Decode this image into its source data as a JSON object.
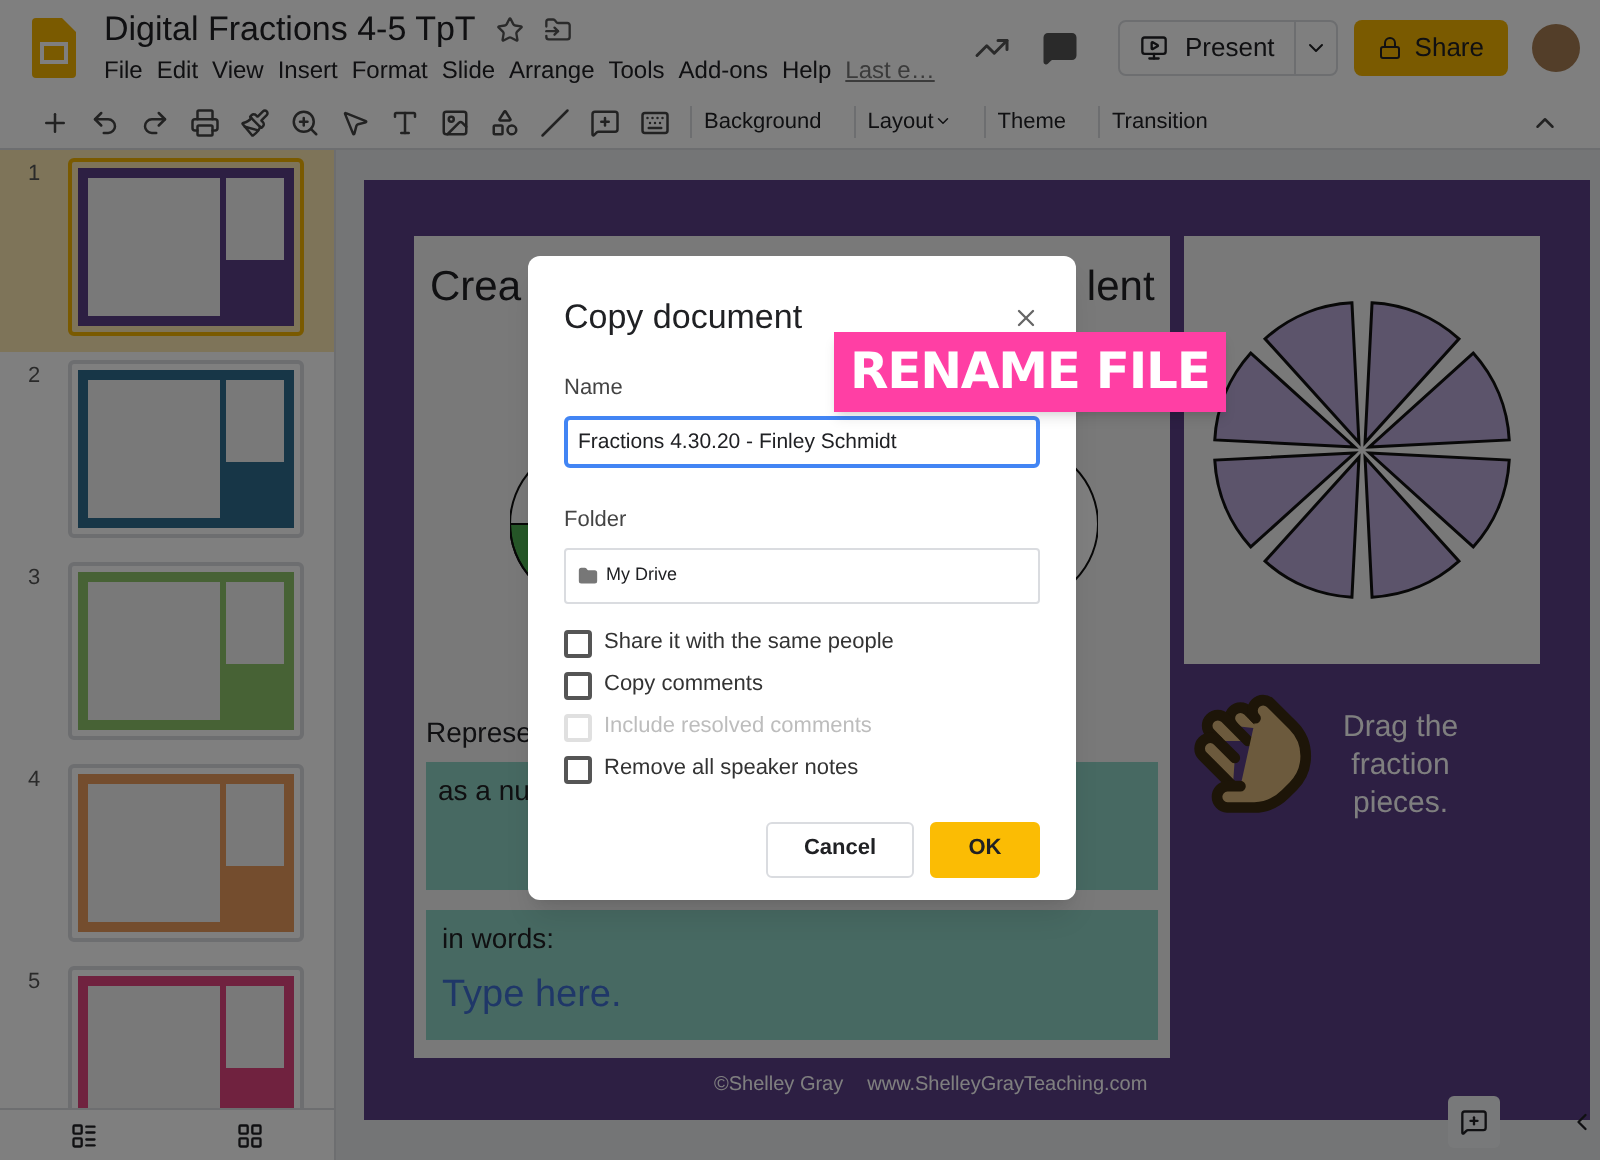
{
  "app": {
    "title": "Digital Fractions 4-5 TpT",
    "menu": [
      "File",
      "Edit",
      "View",
      "Insert",
      "Format",
      "Slide",
      "Arrange",
      "Tools",
      "Add-ons",
      "Help"
    ],
    "last_edit": "Last e…",
    "present": "Present",
    "share": "Share"
  },
  "toolbar": [
    {
      "label": "Background",
      "dropdown": false
    },
    {
      "label": "Layout",
      "dropdown": true
    },
    {
      "label": "Theme",
      "dropdown": false
    },
    {
      "label": "Transition",
      "dropdown": false
    }
  ],
  "filmstrip": [
    {
      "number": "1",
      "selected": true
    },
    {
      "number": "2",
      "selected": false
    },
    {
      "number": "3",
      "selected": false
    },
    {
      "number": "4",
      "selected": false
    },
    {
      "number": "5",
      "selected": false
    }
  ],
  "slide": {
    "title_start": "Crea",
    "title_end": "lent",
    "prompt": "Represe",
    "number_label": "as a nu",
    "words_label": "in words:",
    "words_value": "Type here.",
    "hint": "Drag the fraction pieces.",
    "footer": [
      "©Shelley Gray",
      "www.ShelleyGrayTeaching.com"
    ]
  },
  "dialog": {
    "title": "Copy document",
    "name_label": "Name",
    "name_value": "Fractions 4.30.20 - Finley Schmidt",
    "folder_label": "Folder",
    "folder_value": "My Drive",
    "options": [
      {
        "label": "Share it with the same people",
        "checked": false,
        "disabled": false
      },
      {
        "label": "Copy comments",
        "checked": false,
        "disabled": false
      },
      {
        "label": "Include resolved comments",
        "checked": false,
        "disabled": true
      },
      {
        "label": "Remove all speaker notes",
        "checked": false,
        "disabled": false
      }
    ],
    "buttons": [
      {
        "label": "Cancel",
        "kind": "secondary"
      },
      {
        "label": "OK",
        "kind": "primary"
      }
    ]
  },
  "annotation": "RENAME FILE"
}
